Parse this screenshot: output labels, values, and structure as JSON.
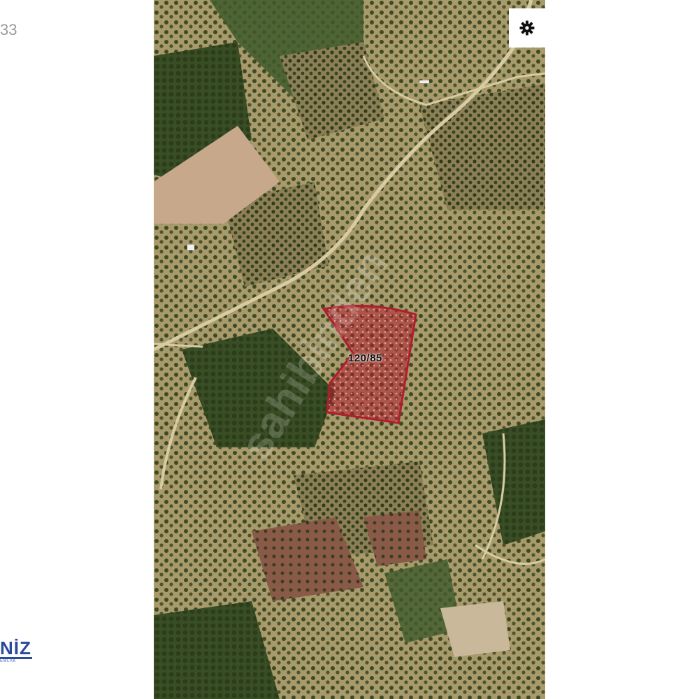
{
  "page": {
    "corner_text": "33"
  },
  "map": {
    "view": "satellite",
    "parcel": {
      "label": "120/85",
      "outline_color": "#b01e2e",
      "fill_color": "#b01e2e"
    },
    "watermark_text": "sahibinden",
    "settings_icon": "gear-icon"
  },
  "logo": {
    "text": "NİZ",
    "subtext": "EMLAK"
  },
  "colors": {
    "vegetation_dark": "#3f5a2c",
    "field_tan": "#c8a88a",
    "road": "#d8cba4"
  }
}
